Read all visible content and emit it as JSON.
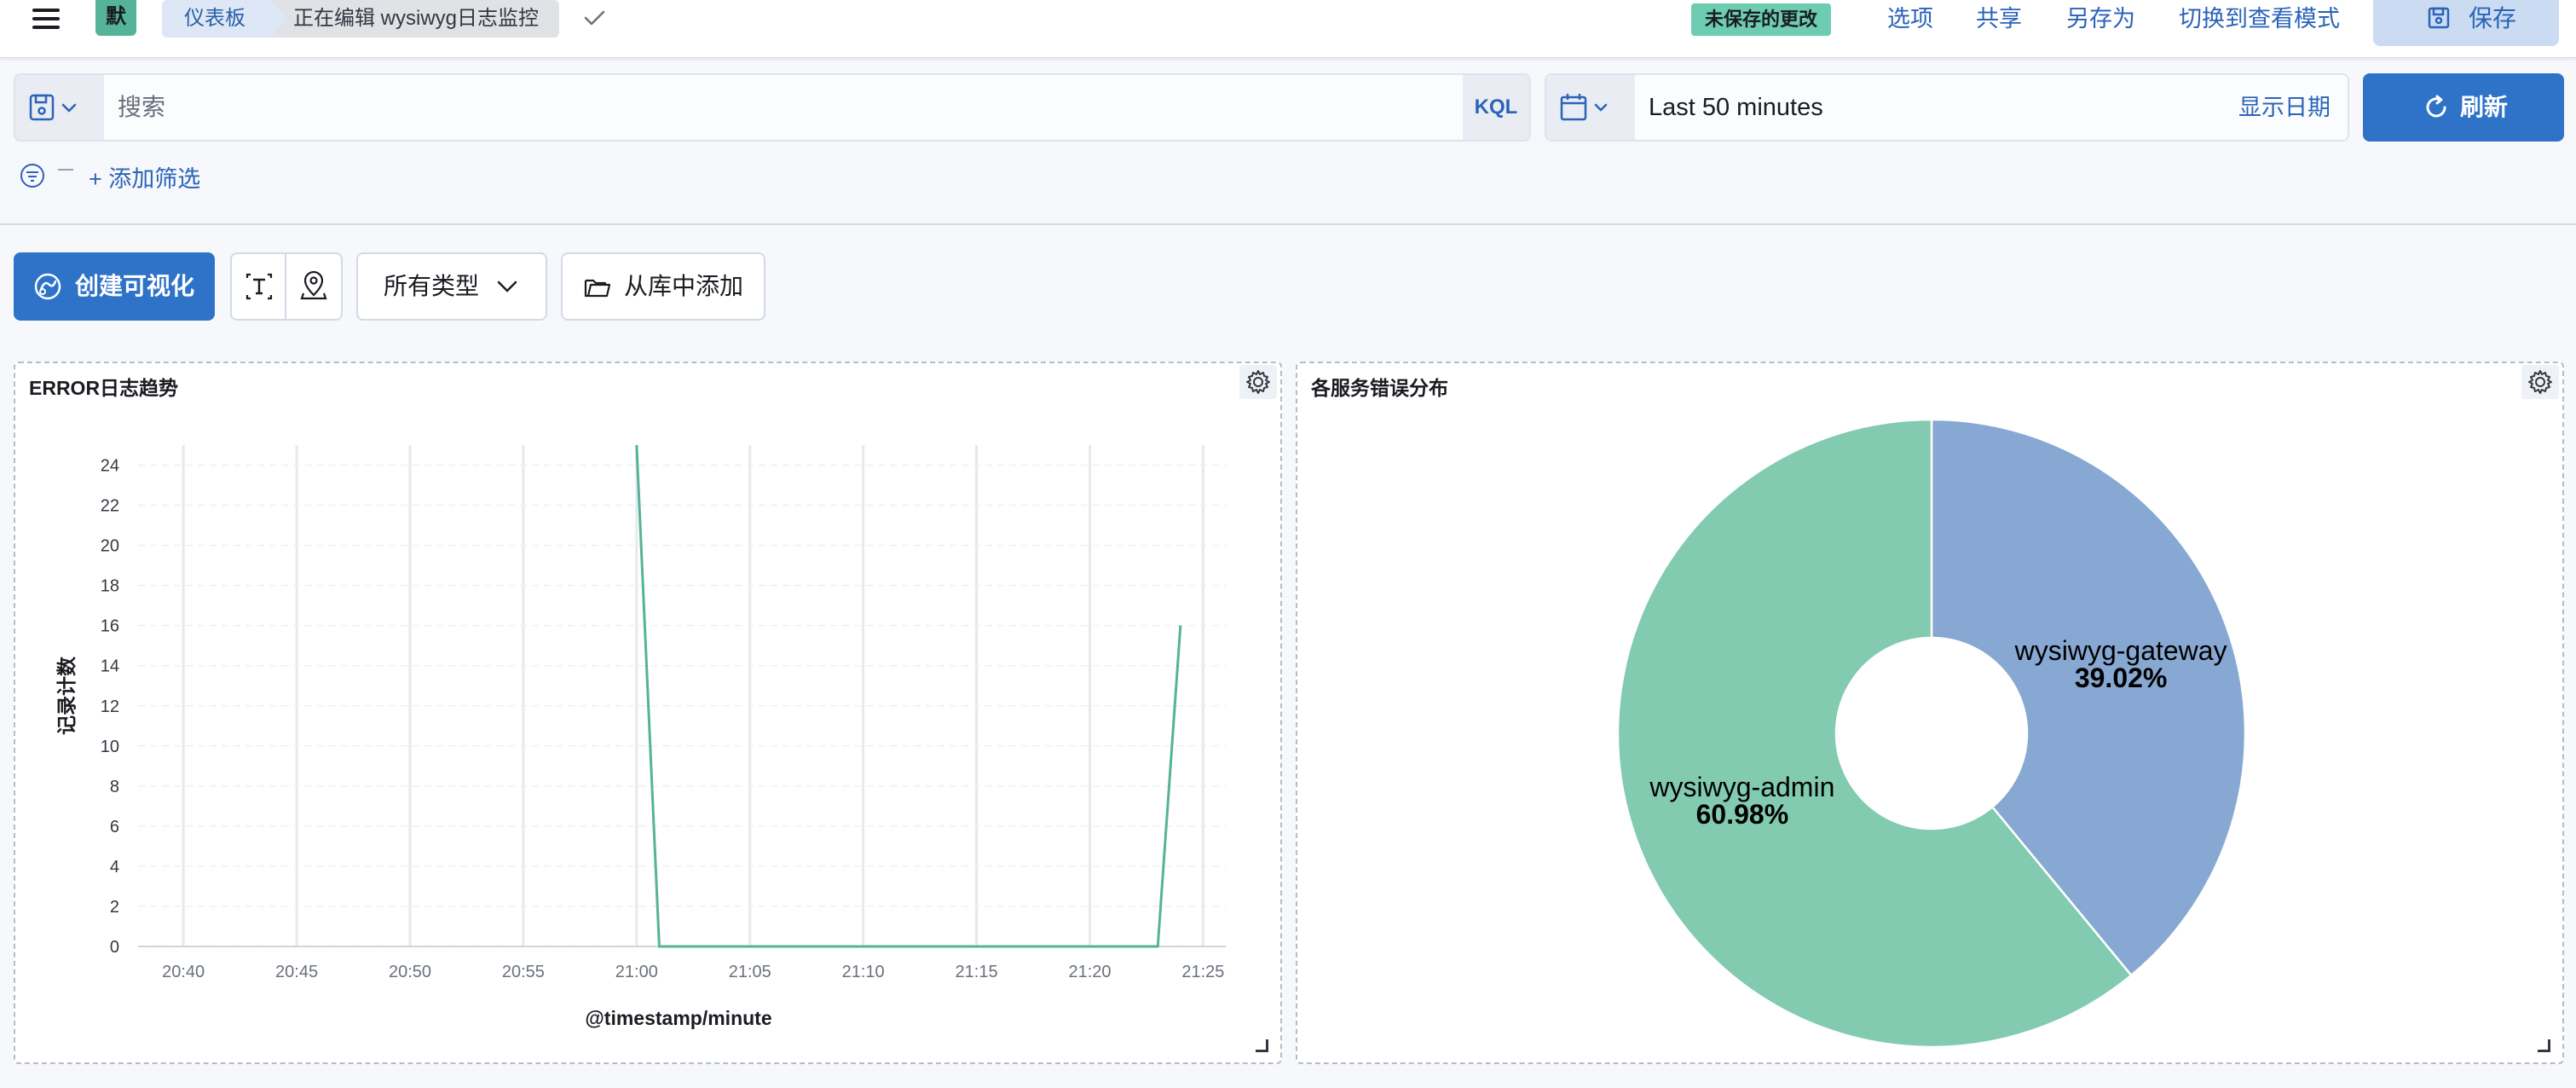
{
  "header": {
    "space_initial": "默",
    "breadcrumbs": [
      "仪表板",
      "正在编辑 wysiwyg日志监控"
    ],
    "unsaved_badge": "未保存的更改",
    "actions": {
      "options": "选项",
      "share": "共享",
      "save_as": "另存为",
      "switch_view": "切换到查看模式",
      "save": "保存"
    }
  },
  "query_bar": {
    "search_placeholder": "搜索",
    "language": "KQL",
    "time_range": "Last 50 minutes",
    "show_dates": "显示日期",
    "refresh": "刷新",
    "add_filter": "+ 添加筛选"
  },
  "toolbar": {
    "create_visualization": "创建可视化",
    "all_types": "所有类型",
    "add_from_library": "从库中添加"
  },
  "colors": {
    "accent": "#2f73c8",
    "series_green": "#54b399",
    "pie_green": "#82cbb0",
    "pie_blue": "#87a8d2",
    "badge": "#6dccb1"
  },
  "panels": [
    {
      "title": "ERROR日志趋势"
    },
    {
      "title": "各服务错误分布"
    }
  ],
  "chart_data": [
    {
      "type": "line",
      "xlabel": "@timestamp/minute",
      "ylabel": "记录计数",
      "x_ticks": [
        "20:40",
        "20:45",
        "20:50",
        "20:55",
        "21:00",
        "21:05",
        "21:10",
        "21:15",
        "21:20",
        "21:25"
      ],
      "y_ticks": [
        0,
        2,
        4,
        6,
        8,
        10,
        12,
        14,
        16,
        18,
        20,
        22,
        24
      ],
      "xlim": [
        "20:38",
        "21:26"
      ],
      "ylim": [
        0,
        25
      ],
      "grid": true,
      "series": [
        {
          "x": [
            "21:00",
            "21:01",
            "21:05",
            "21:10",
            "21:15",
            "21:20",
            "21:23",
            "21:24"
          ],
          "values": [
            25,
            0,
            0,
            0,
            0,
            0,
            0,
            16
          ]
        }
      ]
    },
    {
      "type": "pie",
      "donut": true,
      "slices": [
        {
          "label": "wysiwyg-gateway",
          "value": 39.02,
          "display": "39.02%"
        },
        {
          "label": "wysiwyg-admin",
          "value": 60.98,
          "display": "60.98%"
        }
      ]
    }
  ]
}
